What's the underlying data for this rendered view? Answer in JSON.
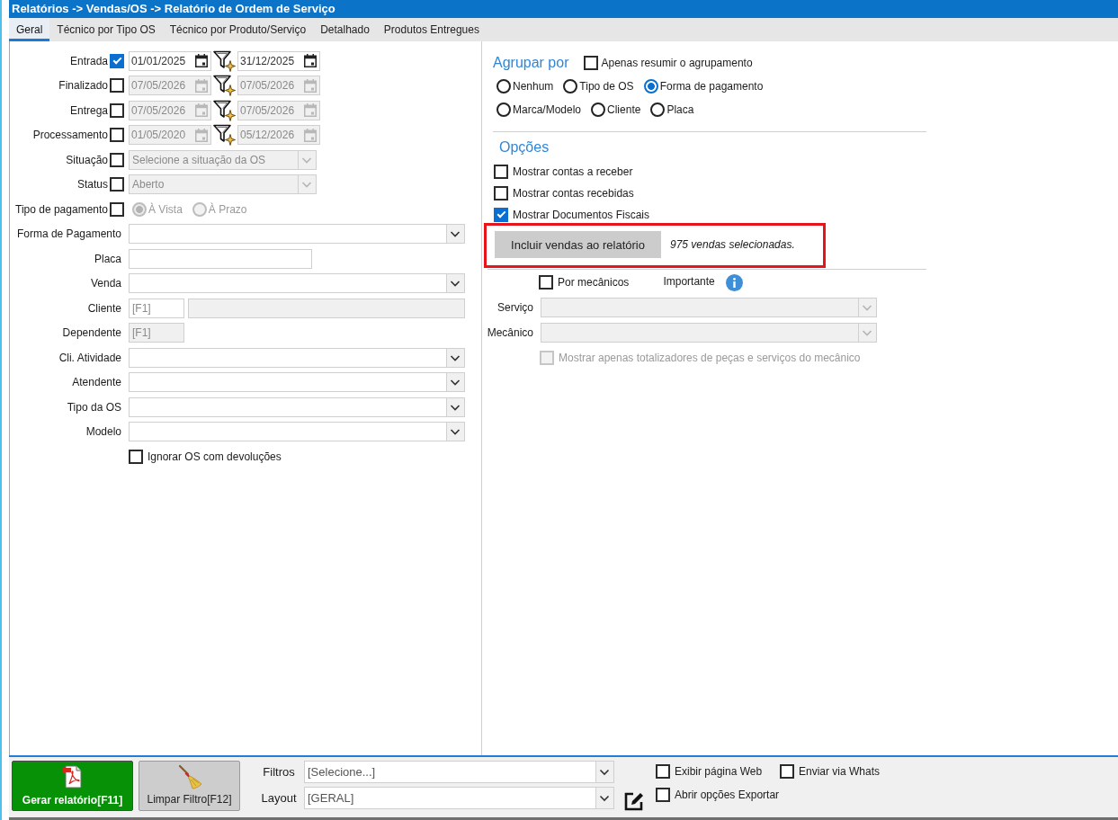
{
  "window": {
    "title": "Relatórios -> Vendas/OS -> Relatório de Ordem de Serviço"
  },
  "tabs": [
    {
      "label": "Geral",
      "selected": true
    },
    {
      "label": "Técnico por Tipo OS",
      "selected": false
    },
    {
      "label": "Técnico por Produto/Serviço",
      "selected": false
    },
    {
      "label": "Detalhado",
      "selected": false
    },
    {
      "label": "Produtos Entregues",
      "selected": false
    }
  ],
  "filters": [
    {
      "kind": "date_range",
      "label": "Entrada",
      "checked": true,
      "from": "01/01/2025",
      "to": "31/12/2025"
    },
    {
      "kind": "date_range",
      "label": "Finalizado",
      "checked": false,
      "from": "07/05/2026",
      "to": "07/05/2026"
    },
    {
      "kind": "date_range",
      "label": "Entrega",
      "checked": false,
      "from": "07/05/2026",
      "to": "07/05/2026"
    },
    {
      "kind": "date_range",
      "label": "Processamento",
      "checked": false,
      "from": "01/05/2020",
      "to": "05/12/2026"
    },
    {
      "kind": "select",
      "label": "Situação",
      "checked": false,
      "value": "Selecione a situação da OS"
    },
    {
      "kind": "select",
      "label": "Status",
      "checked": false,
      "value": "Aberto"
    },
    {
      "kind": "radios",
      "label": "Tipo de pagamento",
      "checked": false,
      "options": [
        {
          "label": "À Vista",
          "selected": true
        },
        {
          "label": "À Prazo",
          "selected": false
        }
      ]
    },
    {
      "kind": "combo",
      "label": "Forma de Pagamento"
    },
    {
      "kind": "text",
      "label": "Placa"
    },
    {
      "kind": "combo",
      "label": "Venda"
    },
    {
      "kind": "lookup",
      "label": "Cliente",
      "placeholder": "[F1]",
      "disabled": false
    },
    {
      "kind": "code",
      "label": "Dependente",
      "placeholder": "[F1]",
      "disabled": true
    },
    {
      "kind": "combo",
      "label": "Cli. Atividade"
    },
    {
      "kind": "combo",
      "label": "Atendente"
    },
    {
      "kind": "combo",
      "label": "Tipo da OS"
    },
    {
      "kind": "combo",
      "label": "Modelo"
    },
    {
      "kind": "checkbox",
      "label": "Ignorar OS com devoluções",
      "checked": false
    }
  ],
  "grouping": {
    "title": "Agrupar por",
    "summary_only": {
      "label": "Apenas resumir o agrupamento",
      "checked": false
    },
    "option_rows": [
      [
        {
          "label": "Nenhum",
          "selected": false
        },
        {
          "label": "Tipo de OS",
          "selected": false
        },
        {
          "label": "Forma de pagamento",
          "selected": true
        }
      ],
      [
        {
          "label": "Marca/Modelo",
          "selected": false
        },
        {
          "label": "Cliente",
          "selected": false
        },
        {
          "label": "Placa",
          "selected": false
        }
      ]
    ]
  },
  "options": {
    "title": "Opções",
    "checkboxes": [
      {
        "label": "Mostrar contas a receber",
        "checked": false
      },
      {
        "label": "Mostrar contas recebidas",
        "checked": false
      },
      {
        "label": "Mostrar Documentos Fiscais",
        "checked": true
      }
    ],
    "include": {
      "highlighted": true,
      "button": "Incluir vendas ao relatório",
      "note": "975 vendas selecionadas."
    }
  },
  "mechanics": {
    "by_mechanic": {
      "label": "Por mecânicos",
      "checked": false
    },
    "important": "Importante",
    "fields": [
      {
        "label": "Serviço",
        "disabled": true
      },
      {
        "label": "Mecânico",
        "disabled": true
      }
    ],
    "totals_only": {
      "label": "Mostrar apenas totalizadores de peças e serviços do mecânico",
      "checked": false,
      "disabled": true
    }
  },
  "footer": {
    "generate_button": "Gerar relatório[F11]",
    "clear_button": "Limpar Filtro[F12]",
    "selects": [
      {
        "label": "Filtros",
        "value": "[Selecione...]"
      },
      {
        "label": "Layout",
        "value": "[GERAL]"
      }
    ],
    "checkboxes": [
      {
        "label": "Exibir página Web",
        "checked": false
      },
      {
        "label": "Enviar via Whats",
        "checked": false
      },
      {
        "label": "Abrir opções Exportar",
        "checked": false
      }
    ]
  }
}
